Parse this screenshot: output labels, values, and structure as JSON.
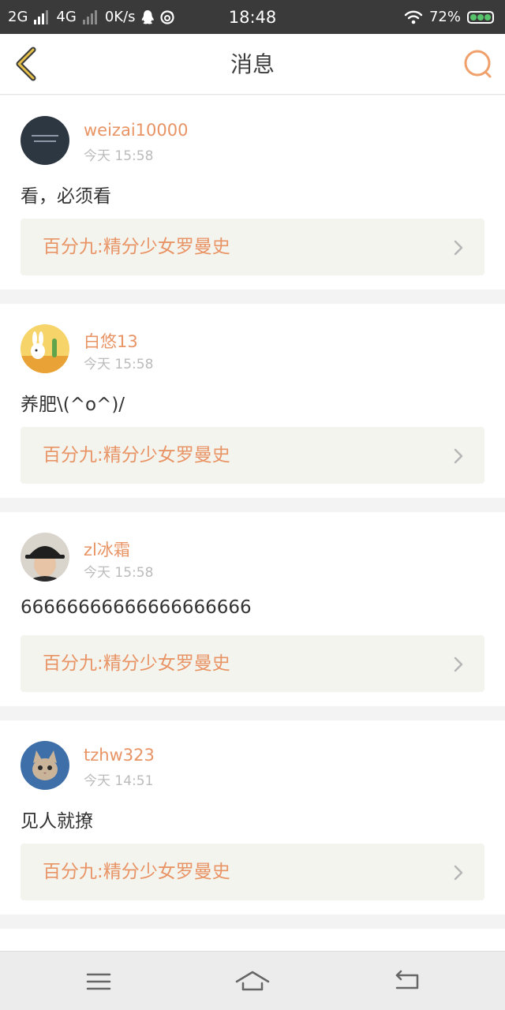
{
  "status_bar": {
    "network1": "2G",
    "network2": "4G",
    "speed": "0K/s",
    "time": "18:48",
    "battery": "72%"
  },
  "header": {
    "title": "消息"
  },
  "messages": [
    {
      "username": "weizai10000",
      "time": "今天 15:58",
      "content": "看，必须看",
      "link": "百分九:精分少女罗曼史",
      "avatar_icon": "dark-text-avatar"
    },
    {
      "username": "白悠13",
      "time": "今天 15:58",
      "content": "养肥\\(^o^)/",
      "link": "百分九:精分少女罗曼史",
      "avatar_icon": "cartoon-rabbit-avatar"
    },
    {
      "username": "zl冰霜",
      "time": "今天 15:58",
      "content": "66666666666666666666",
      "link": "百分九:精分少女罗曼史",
      "avatar_icon": "person-hat-avatar"
    },
    {
      "username": "tzhw323",
      "time": "今天 14:51",
      "content": "见人就撩",
      "link": "百分九:精分少女罗曼史",
      "avatar_icon": "kitten-avatar"
    }
  ],
  "colors": {
    "accent": "#e89465",
    "status_bar": "#3a3a3a",
    "link_bg": "#f4f4ef"
  }
}
